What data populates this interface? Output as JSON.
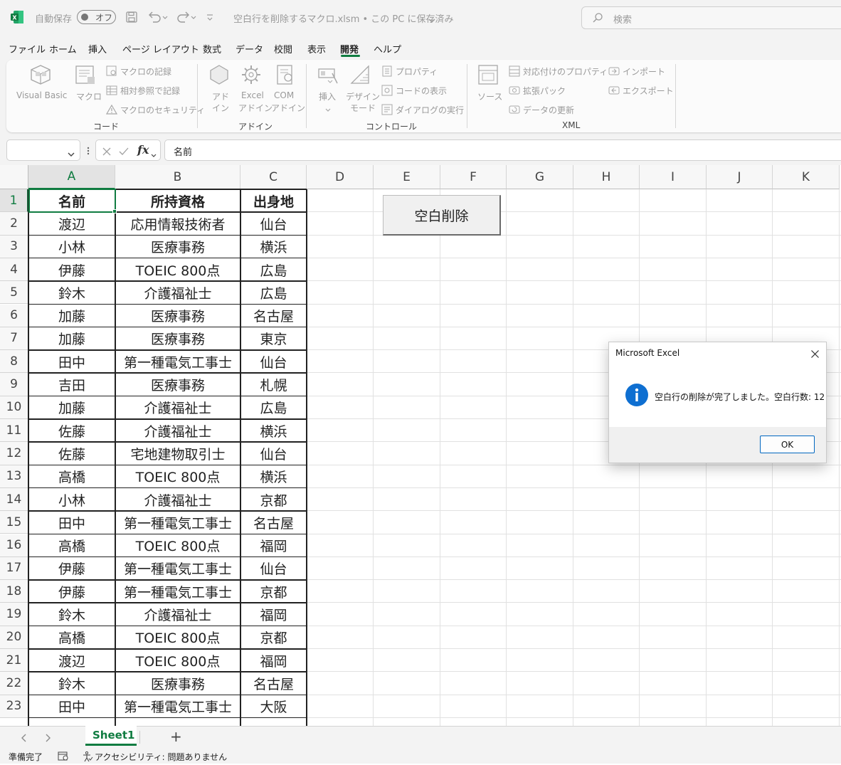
{
  "titlebar": {
    "autosave_label": "自動保存",
    "toggle_label": "オフ",
    "file_title": "空白行を削除するマクロ.xlsm • この PC に保存済み",
    "search_placeholder": "検索"
  },
  "menu": {
    "items": [
      "ファイル",
      "ホーム",
      "挿入",
      "ページ レイアウト",
      "数式",
      "データ",
      "校閲",
      "表示",
      "開発",
      "ヘルプ"
    ],
    "active_index": 8
  },
  "ribbon": {
    "code": {
      "visual_basic": "Visual Basic",
      "macro": "マクロ",
      "record_macro": "マクロの記録",
      "relative_ref": "相対参照で記録",
      "macro_security": "マクロのセキュリティ",
      "group_label": "コード"
    },
    "addins": {
      "addin_line1": "アド",
      "addin_line2": "イン",
      "excel_line1": "Excel",
      "excel_line2": "アドイン",
      "com_line1": "COM",
      "com_line2": "アドイン",
      "group_label": "アドイン"
    },
    "controls": {
      "insert": "挿入",
      "design_line1": "デザイン",
      "design_line2": "モード",
      "properties": "プロパティ",
      "view_code": "コードの表示",
      "run_dialog": "ダイアログの実行",
      "group_label": "コントロール"
    },
    "xml": {
      "source": "ソース",
      "map_properties": "対応付けのプロパティ",
      "expansion_packs": "拡張パック",
      "refresh_data": "データの更新",
      "import": "インポート",
      "export": "エクスポート",
      "group_label": "XML"
    }
  },
  "formula_bar": {
    "name_box": "",
    "fx": "fx",
    "content": "名前"
  },
  "grid": {
    "columns": [
      "A",
      "B",
      "C",
      "D",
      "E",
      "F",
      "G",
      "H",
      "I",
      "J",
      "K"
    ],
    "rows": [
      "1",
      "2",
      "3",
      "4",
      "5",
      "6",
      "7",
      "8",
      "9",
      "10",
      "11",
      "12",
      "13",
      "14",
      "15",
      "16",
      "17",
      "18",
      "19",
      "20",
      "21",
      "22",
      "23"
    ],
    "headers": [
      "名前",
      "所持資格",
      "出身地"
    ],
    "data": [
      [
        "渡辺",
        "応用情報技術者",
        "仙台"
      ],
      [
        "小林",
        "医療事務",
        "横浜"
      ],
      [
        "伊藤",
        "TOEIC 800点",
        "広島"
      ],
      [
        "鈴木",
        "介護福祉士",
        "広島"
      ],
      [
        "加藤",
        "医療事務",
        "名古屋"
      ],
      [
        "加藤",
        "医療事務",
        "東京"
      ],
      [
        "田中",
        "第一種電気工事士",
        "仙台"
      ],
      [
        "吉田",
        "医療事務",
        "札幌"
      ],
      [
        "加藤",
        "介護福祉士",
        "広島"
      ],
      [
        "佐藤",
        "介護福祉士",
        "横浜"
      ],
      [
        "佐藤",
        "宅地建物取引士",
        "仙台"
      ],
      [
        "高橋",
        "TOEIC 800点",
        "横浜"
      ],
      [
        "小林",
        "介護福祉士",
        "京都"
      ],
      [
        "田中",
        "第一種電気工事士",
        "名古屋"
      ],
      [
        "高橋",
        "TOEIC 800点",
        "福岡"
      ],
      [
        "伊藤",
        "第一種電気工事士",
        "仙台"
      ],
      [
        "伊藤",
        "第一種電気工事士",
        "京都"
      ],
      [
        "鈴木",
        "介護福祉士",
        "福岡"
      ],
      [
        "高橋",
        "TOEIC 800点",
        "京都"
      ],
      [
        "渡辺",
        "TOEIC 800点",
        "福岡"
      ],
      [
        "鈴木",
        "医療事務",
        "名古屋"
      ],
      [
        "田中",
        "第一種電気工事士",
        "大阪"
      ]
    ],
    "macro_button": "空白削除"
  },
  "sheets": {
    "tabs": [
      "Sheet1"
    ],
    "add": "+"
  },
  "status": {
    "ready": "準備完了",
    "accessibility": "アクセシビリティ: 問題ありません"
  },
  "dialog": {
    "title": "Microsoft Excel",
    "message": "空白行の削除が完了しました。空白行数: 12",
    "ok": "OK"
  }
}
